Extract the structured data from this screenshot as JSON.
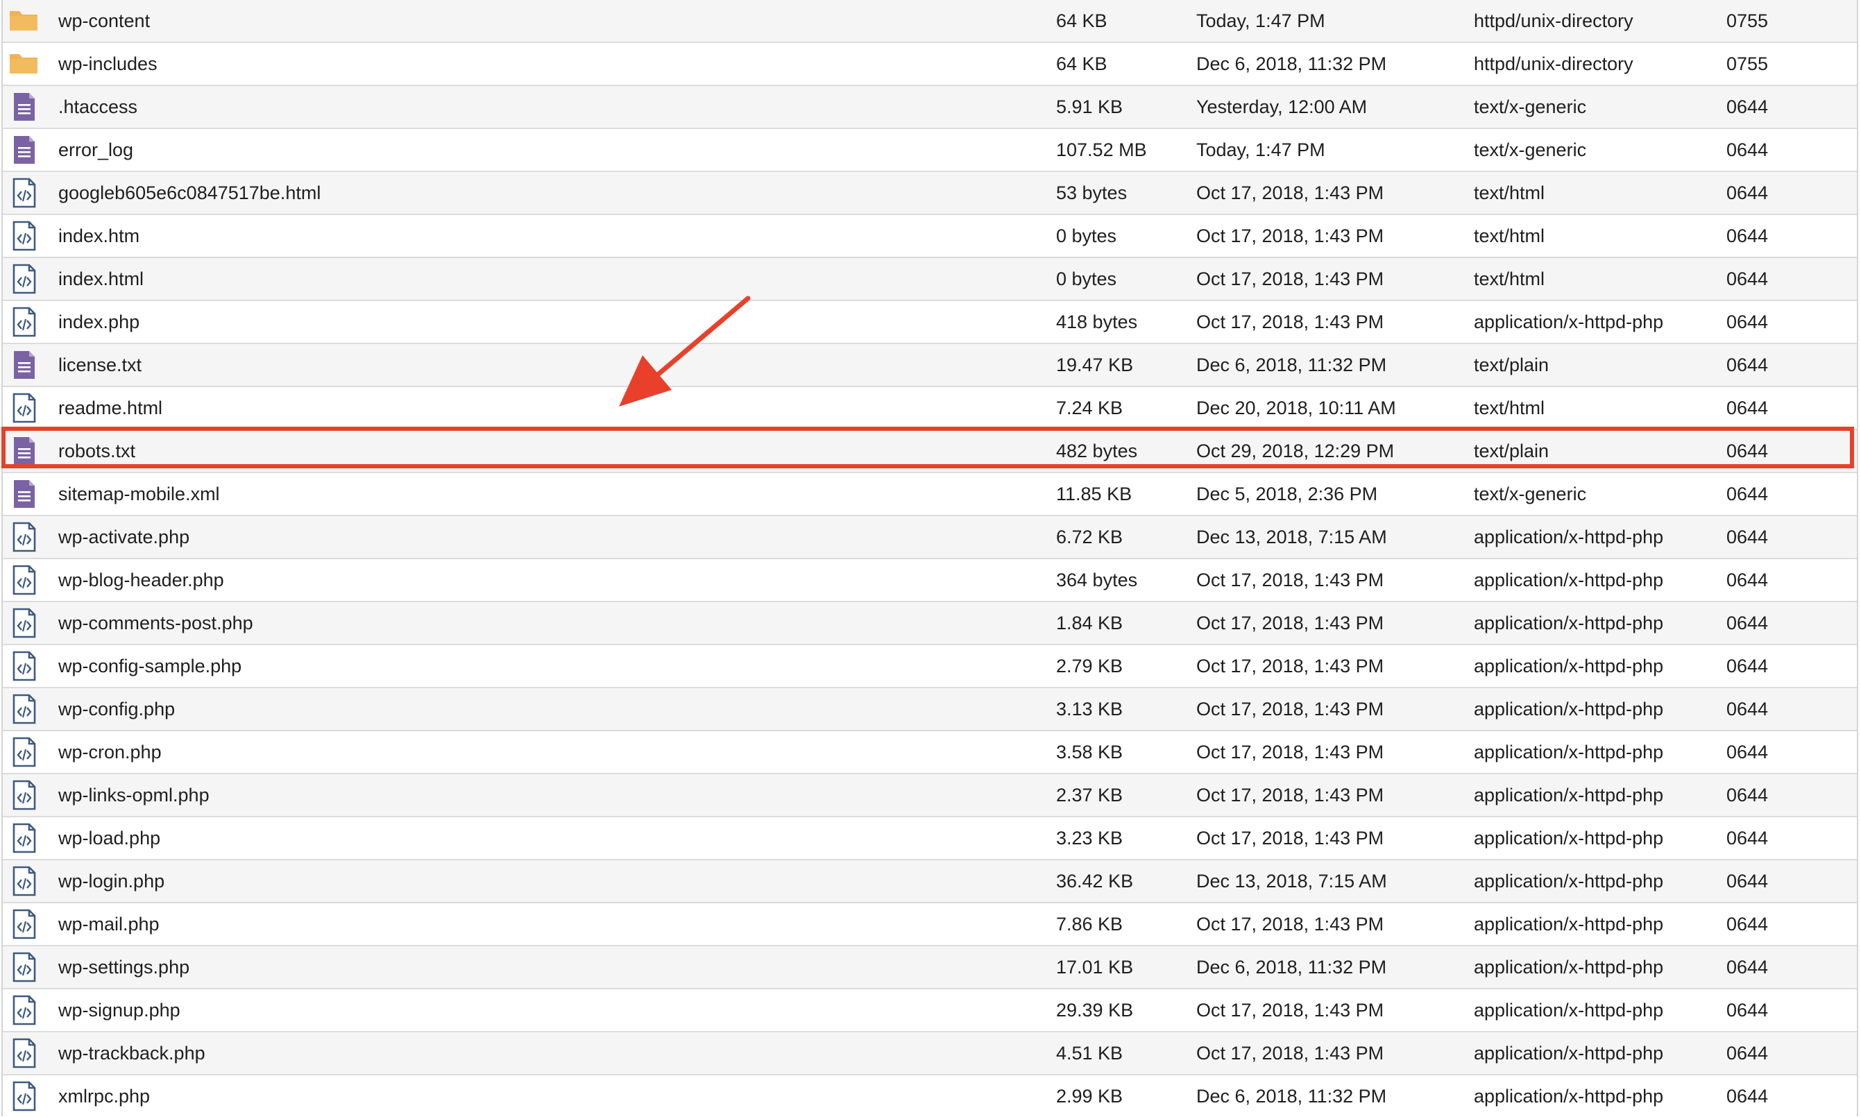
{
  "icons": {
    "folder": "folder-icon",
    "text": "text-file-icon",
    "code": "code-file-icon"
  },
  "colors": {
    "folder": "#f0b354",
    "text_file": "#7b62a3",
    "code_file": "#3e5a7e",
    "highlight": "#e8402a",
    "row_alt": "#f5f5f5"
  },
  "files": [
    {
      "icon": "folder",
      "name": "wp-content",
      "size": "64 KB",
      "modified": "Today, 1:47 PM",
      "type": "httpd/unix-directory",
      "perms": "0755"
    },
    {
      "icon": "folder",
      "name": "wp-includes",
      "size": "64 KB",
      "modified": "Dec 6, 2018, 11:32 PM",
      "type": "httpd/unix-directory",
      "perms": "0755"
    },
    {
      "icon": "text",
      "name": ".htaccess",
      "size": "5.91 KB",
      "modified": "Yesterday, 12:00 AM",
      "type": "text/x-generic",
      "perms": "0644"
    },
    {
      "icon": "text",
      "name": "error_log",
      "size": "107.52 MB",
      "modified": "Today, 1:47 PM",
      "type": "text/x-generic",
      "perms": "0644"
    },
    {
      "icon": "code",
      "name": "googleb605e6c0847517be.html",
      "size": "53 bytes",
      "modified": "Oct 17, 2018, 1:43 PM",
      "type": "text/html",
      "perms": "0644"
    },
    {
      "icon": "code",
      "name": "index.htm",
      "size": "0 bytes",
      "modified": "Oct 17, 2018, 1:43 PM",
      "type": "text/html",
      "perms": "0644"
    },
    {
      "icon": "code",
      "name": "index.html",
      "size": "0 bytes",
      "modified": "Oct 17, 2018, 1:43 PM",
      "type": "text/html",
      "perms": "0644"
    },
    {
      "icon": "code",
      "name": "index.php",
      "size": "418 bytes",
      "modified": "Oct 17, 2018, 1:43 PM",
      "type": "application/x-httpd-php",
      "perms": "0644"
    },
    {
      "icon": "text",
      "name": "license.txt",
      "size": "19.47 KB",
      "modified": "Dec 6, 2018, 11:32 PM",
      "type": "text/plain",
      "perms": "0644"
    },
    {
      "icon": "code",
      "name": "readme.html",
      "size": "7.24 KB",
      "modified": "Dec 20, 2018, 10:11 AM",
      "type": "text/html",
      "perms": "0644"
    },
    {
      "icon": "text",
      "name": "robots.txt",
      "size": "482 bytes",
      "modified": "Oct 29, 2018, 12:29 PM",
      "type": "text/plain",
      "perms": "0644",
      "highlighted": true
    },
    {
      "icon": "text",
      "name": "sitemap-mobile.xml",
      "size": "11.85 KB",
      "modified": "Dec 5, 2018, 2:36 PM",
      "type": "text/x-generic",
      "perms": "0644"
    },
    {
      "icon": "code",
      "name": "wp-activate.php",
      "size": "6.72 KB",
      "modified": "Dec 13, 2018, 7:15 AM",
      "type": "application/x-httpd-php",
      "perms": "0644"
    },
    {
      "icon": "code",
      "name": "wp-blog-header.php",
      "size": "364 bytes",
      "modified": "Oct 17, 2018, 1:43 PM",
      "type": "application/x-httpd-php",
      "perms": "0644"
    },
    {
      "icon": "code",
      "name": "wp-comments-post.php",
      "size": "1.84 KB",
      "modified": "Oct 17, 2018, 1:43 PM",
      "type": "application/x-httpd-php",
      "perms": "0644"
    },
    {
      "icon": "code",
      "name": "wp-config-sample.php",
      "size": "2.79 KB",
      "modified": "Oct 17, 2018, 1:43 PM",
      "type": "application/x-httpd-php",
      "perms": "0644"
    },
    {
      "icon": "code",
      "name": "wp-config.php",
      "size": "3.13 KB",
      "modified": "Oct 17, 2018, 1:43 PM",
      "type": "application/x-httpd-php",
      "perms": "0644"
    },
    {
      "icon": "code",
      "name": "wp-cron.php",
      "size": "3.58 KB",
      "modified": "Oct 17, 2018, 1:43 PM",
      "type": "application/x-httpd-php",
      "perms": "0644"
    },
    {
      "icon": "code",
      "name": "wp-links-opml.php",
      "size": "2.37 KB",
      "modified": "Oct 17, 2018, 1:43 PM",
      "type": "application/x-httpd-php",
      "perms": "0644"
    },
    {
      "icon": "code",
      "name": "wp-load.php",
      "size": "3.23 KB",
      "modified": "Oct 17, 2018, 1:43 PM",
      "type": "application/x-httpd-php",
      "perms": "0644"
    },
    {
      "icon": "code",
      "name": "wp-login.php",
      "size": "36.42 KB",
      "modified": "Dec 13, 2018, 7:15 AM",
      "type": "application/x-httpd-php",
      "perms": "0644"
    },
    {
      "icon": "code",
      "name": "wp-mail.php",
      "size": "7.86 KB",
      "modified": "Oct 17, 2018, 1:43 PM",
      "type": "application/x-httpd-php",
      "perms": "0644"
    },
    {
      "icon": "code",
      "name": "wp-settings.php",
      "size": "17.01 KB",
      "modified": "Dec 6, 2018, 11:32 PM",
      "type": "application/x-httpd-php",
      "perms": "0644"
    },
    {
      "icon": "code",
      "name": "wp-signup.php",
      "size": "29.39 KB",
      "modified": "Oct 17, 2018, 1:43 PM",
      "type": "application/x-httpd-php",
      "perms": "0644"
    },
    {
      "icon": "code",
      "name": "wp-trackback.php",
      "size": "4.51 KB",
      "modified": "Oct 17, 2018, 1:43 PM",
      "type": "application/x-httpd-php",
      "perms": "0644"
    },
    {
      "icon": "code",
      "name": "xmlrpc.php",
      "size": "2.99 KB",
      "modified": "Dec 6, 2018, 11:32 PM",
      "type": "application/x-httpd-php",
      "perms": "0644"
    }
  ]
}
